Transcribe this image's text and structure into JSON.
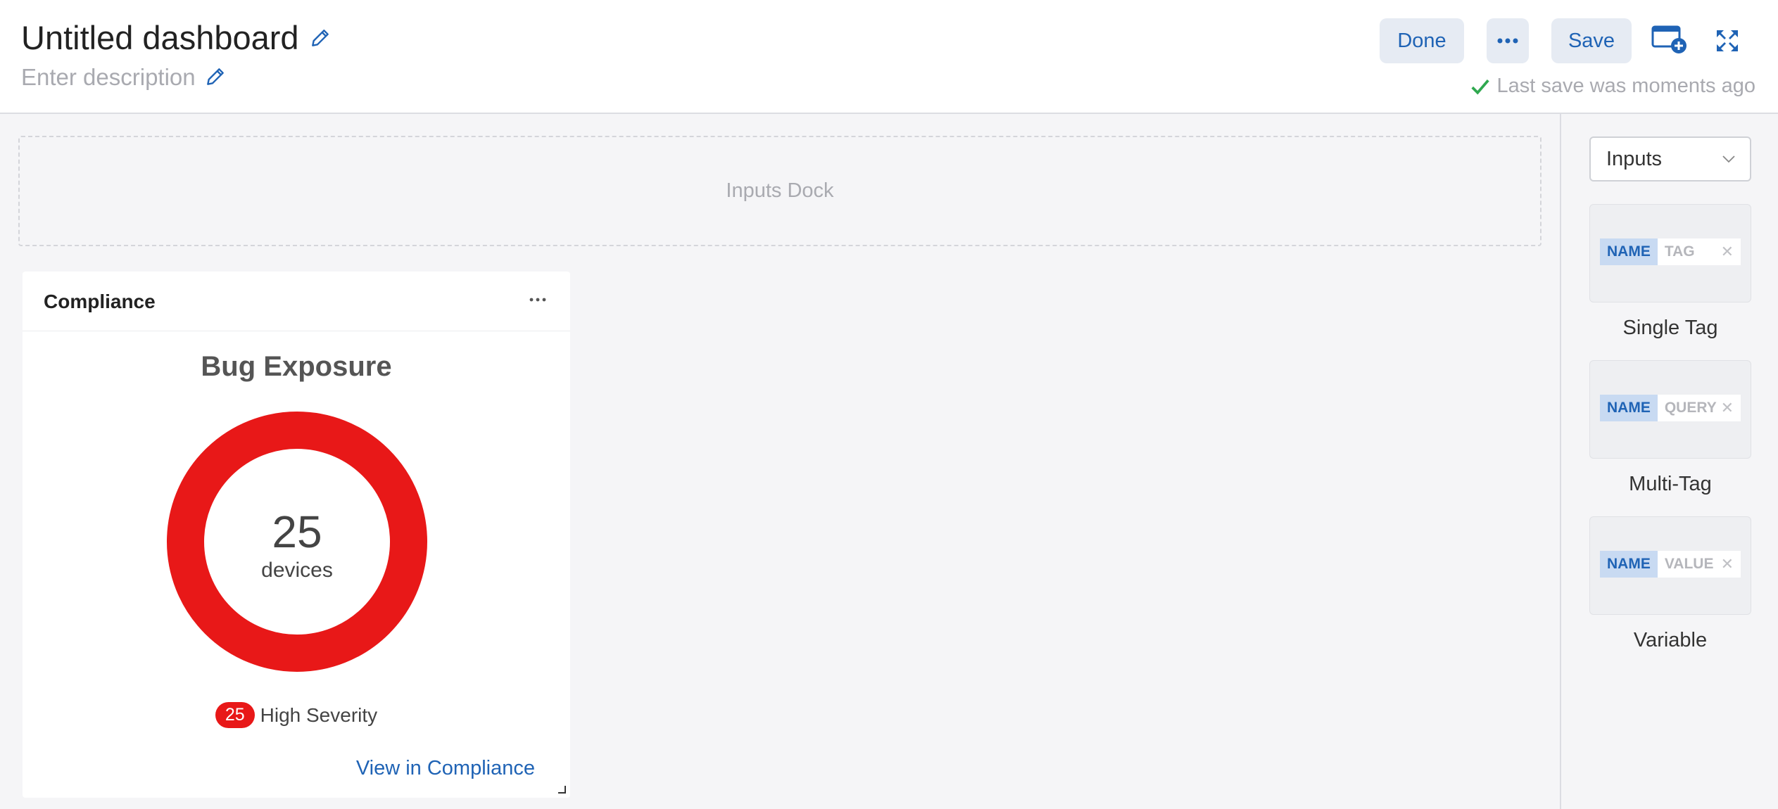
{
  "header": {
    "title": "Untitled dashboard",
    "description_placeholder": "Enter description",
    "done_label": "Done",
    "save_label": "Save",
    "last_save": "Last save was moments ago"
  },
  "dock": {
    "label": "Inputs Dock"
  },
  "widget": {
    "title": "Compliance",
    "chart_title": "Bug Exposure",
    "center_value": "25",
    "center_unit": "devices",
    "legend_count": "25",
    "legend_label": "High Severity",
    "link_label": "View in Compliance",
    "accent_color": "#e81818",
    "chart_data": {
      "type": "pie",
      "title": "Bug Exposure",
      "categories": [
        "High Severity"
      ],
      "values": [
        25
      ],
      "colors": [
        "#e81818"
      ]
    }
  },
  "panel": {
    "select_value": "Inputs",
    "items": [
      {
        "name": "NAME",
        "value": "TAG",
        "label": "Single Tag"
      },
      {
        "name": "NAME",
        "value": "QUERY",
        "label": "Multi-Tag"
      },
      {
        "name": "NAME",
        "value": "VALUE",
        "label": "Variable"
      }
    ]
  },
  "colors": {
    "accent": "#1f63b5",
    "severity_high": "#e81818",
    "success": "#2fa84f"
  }
}
